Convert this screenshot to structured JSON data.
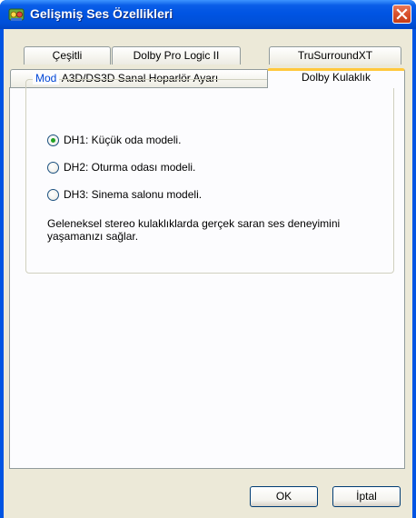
{
  "window": {
    "title": "Gelişmiş Ses Özellikleri"
  },
  "tabs": {
    "row1": [
      "Çeşitli",
      "Dolby Pro Logic II",
      "TruSurroundXT"
    ],
    "row2": [
      "A3D/DS3D Sanal Hoparlör Ayarı",
      "Dolby Kulaklık"
    ],
    "active": "Dolby Kulaklık"
  },
  "mode_group": {
    "legend": "Mod",
    "options": [
      {
        "label": "DH1: Küçük oda modeli.",
        "checked": true
      },
      {
        "label": "DH2: Oturma odası modeli.",
        "checked": false
      },
      {
        "label": "DH3: Sinema salonu modeli.",
        "checked": false
      }
    ],
    "description": "Geleneksel stereo kulaklıklarda gerçek saran ses deneyimini yaşamanızı sağlar."
  },
  "buttons": {
    "ok": "OK",
    "cancel": "İptal"
  },
  "colors": {
    "title_bar": "#0054e3",
    "active_tab_accent": "#ffc83c",
    "group_legend": "#0046d5",
    "radio_dot": "#21a121"
  }
}
